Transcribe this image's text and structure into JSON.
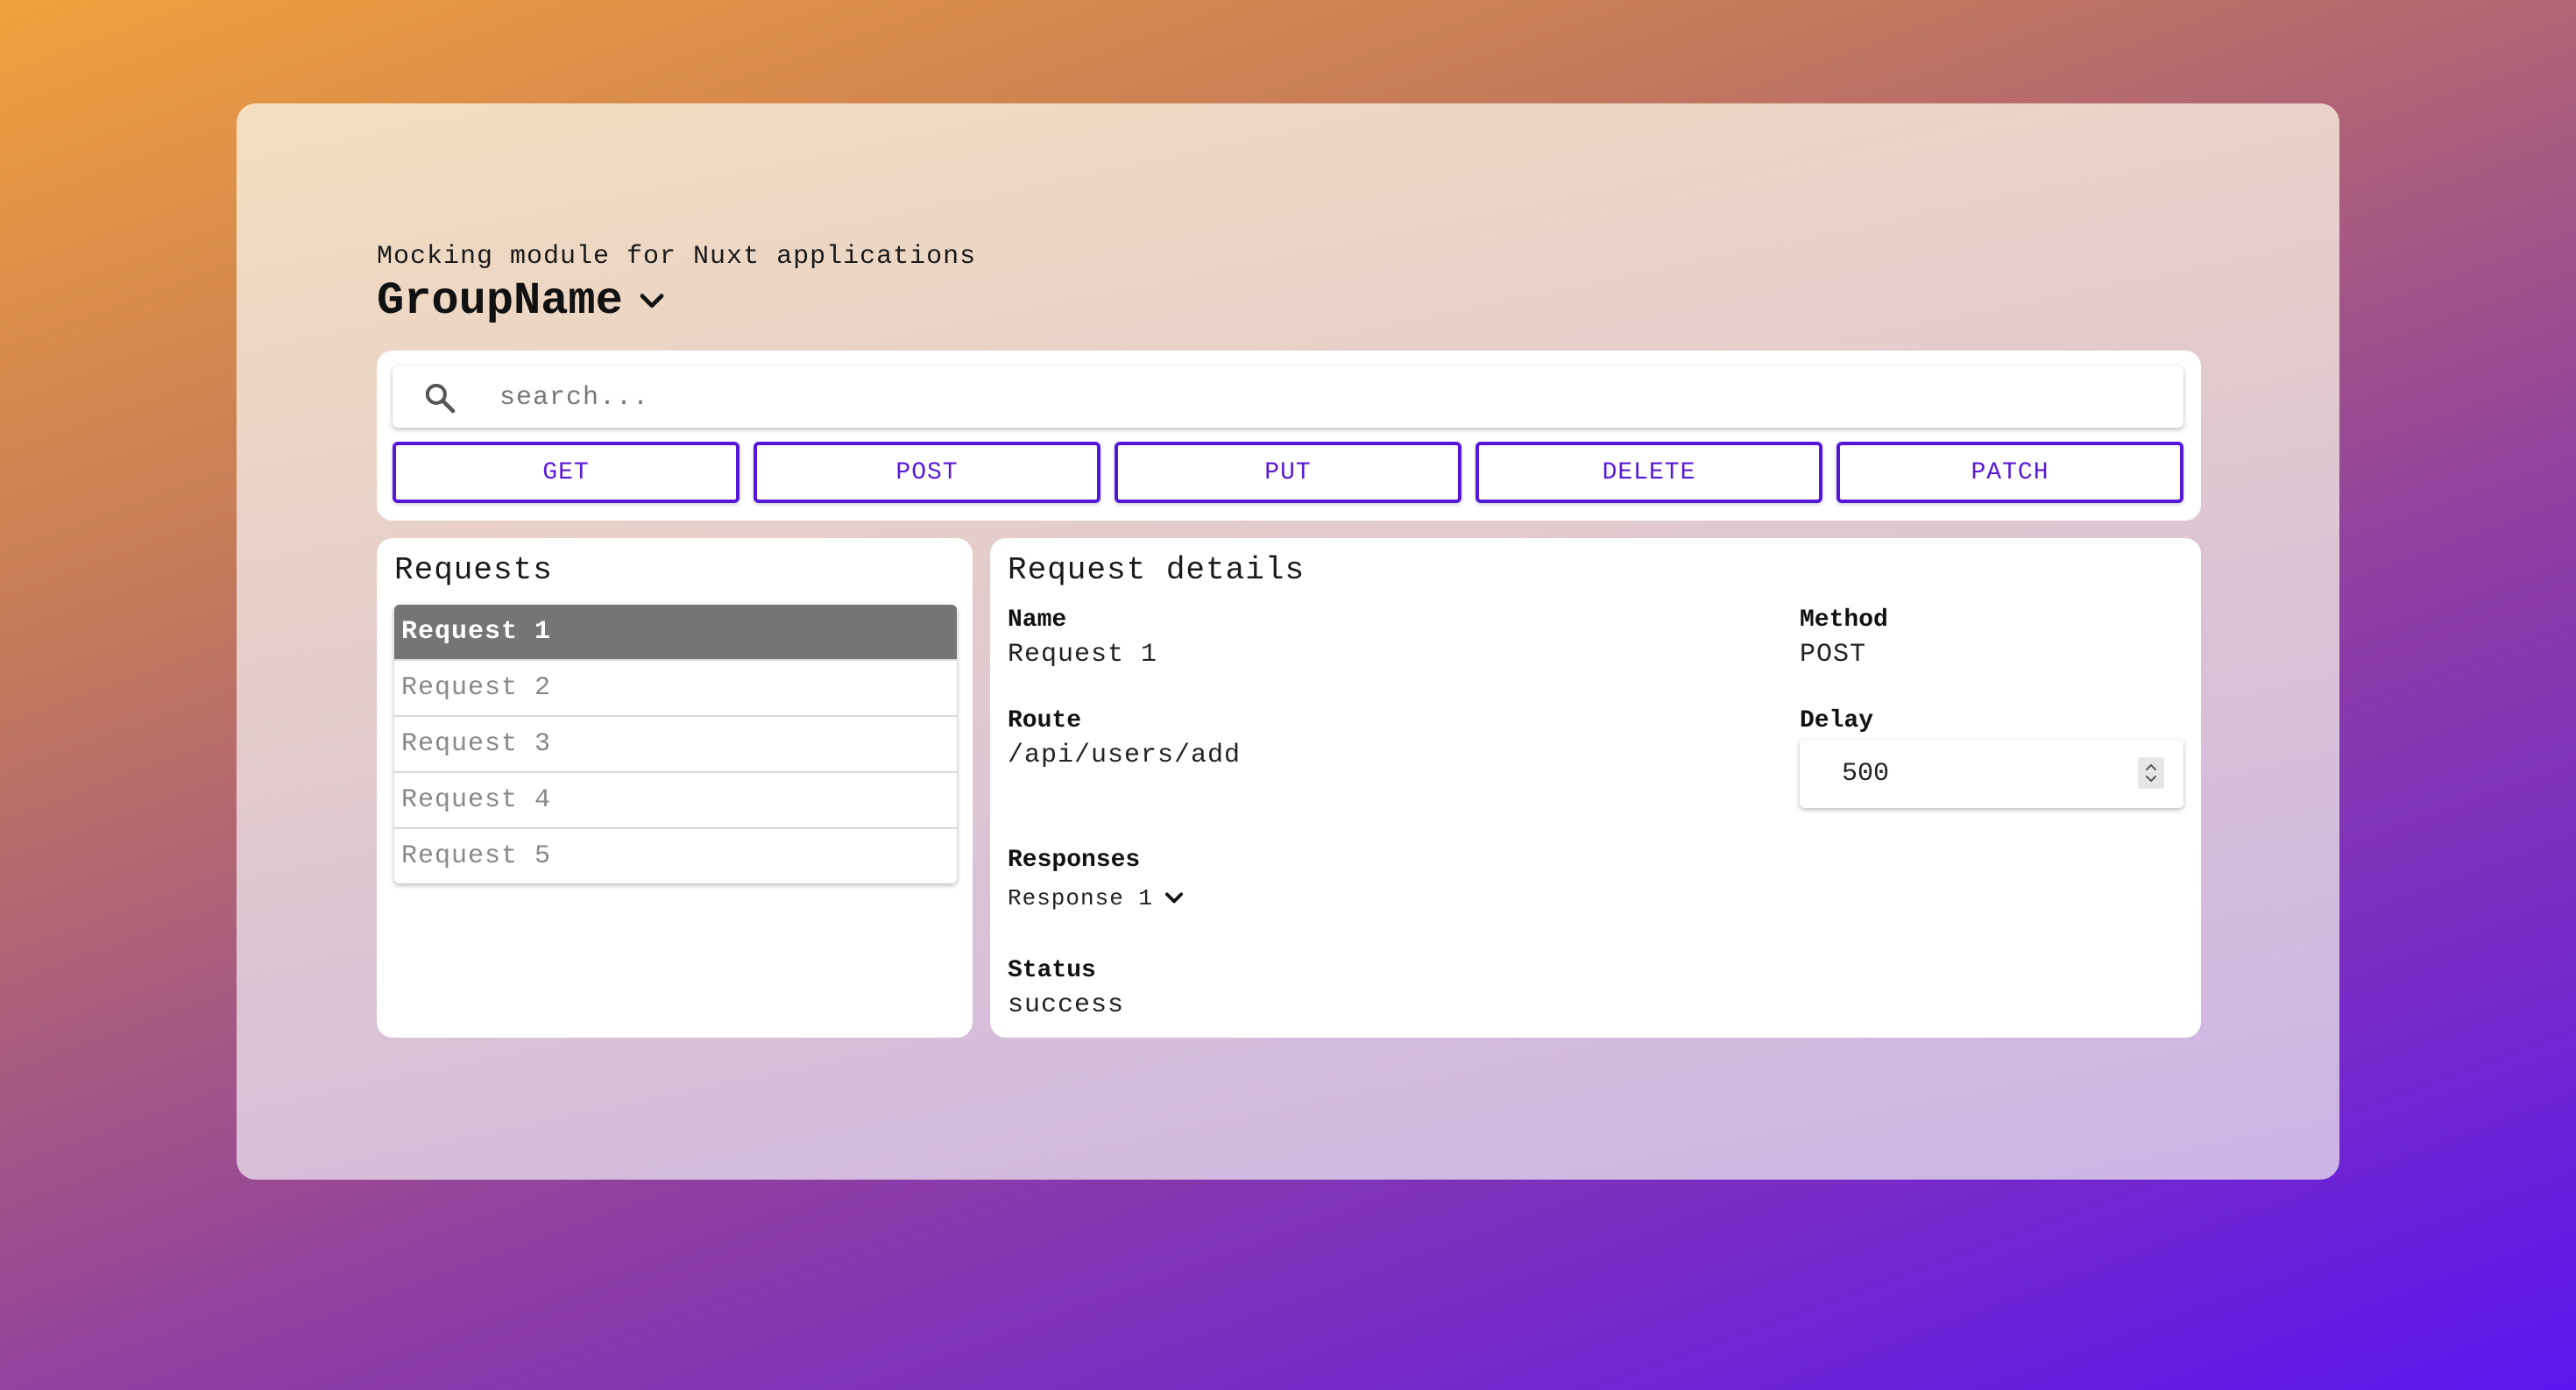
{
  "header": {
    "subtitle": "Mocking module for Nuxt applications",
    "group_name": "GroupName"
  },
  "search": {
    "placeholder": "search...",
    "value": ""
  },
  "methods": [
    "GET",
    "POST",
    "PUT",
    "DELETE",
    "PATCH"
  ],
  "requests": {
    "title": "Requests",
    "items": [
      {
        "label": "Request 1",
        "active": true
      },
      {
        "label": "Request 2",
        "active": false
      },
      {
        "label": "Request 3",
        "active": false
      },
      {
        "label": "Request 4",
        "active": false
      },
      {
        "label": "Request 5",
        "active": false
      }
    ]
  },
  "details": {
    "title": "Request details",
    "name_label": "Name",
    "name_value": "Request 1",
    "method_label": "Method",
    "method_value": "POST",
    "route_label": "Route",
    "route_value": "/api/users/add",
    "delay_label": "Delay",
    "delay_value": "500",
    "responses_label": "Responses",
    "response_selected": "Response 1",
    "status_label": "Status",
    "status_value": "success"
  },
  "icons": {
    "search": "search-icon",
    "group_dropdown": "chevron-down-icon",
    "response_dropdown": "chevron-down-icon",
    "delay_spinner": "spinner-icon"
  },
  "colors": {
    "accent": "#5417d9",
    "active_row": "#757575"
  }
}
